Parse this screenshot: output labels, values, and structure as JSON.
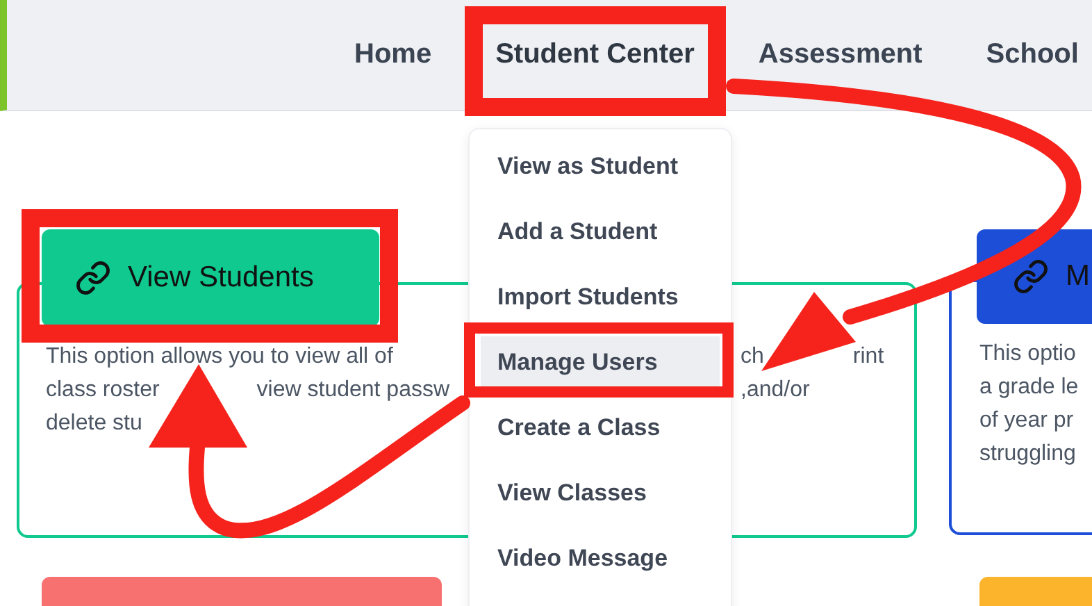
{
  "nav": {
    "items": [
      {
        "label": "Home",
        "selected": false
      },
      {
        "label": "Student Center",
        "selected": true
      },
      {
        "label": "Assessment",
        "selected": false
      },
      {
        "label": "School",
        "selected": false
      }
    ]
  },
  "menu": {
    "items": [
      {
        "label": "View as Student",
        "selected": false
      },
      {
        "label": "Add a Student",
        "selected": false
      },
      {
        "label": "Import Students",
        "selected": false
      },
      {
        "label": "Manage Users",
        "selected": true
      },
      {
        "label": "Create a Class",
        "selected": false
      },
      {
        "label": "View Classes",
        "selected": false
      },
      {
        "label": "Video Message",
        "selected": false
      }
    ]
  },
  "cards": [
    {
      "title": "View Students",
      "color": "#10c98f",
      "lines": [
        {
          "left": [
            "This option allows you to view all of"
          ],
          "right": [
            "ch",
            "rint"
          ]
        },
        {
          "left": [
            "class roster",
            "view student passw"
          ],
          "right": [
            ",and/or"
          ]
        },
        {
          "left": [
            "delete stu"
          ]
        }
      ]
    },
    {
      "title": "M",
      "color": "#1d4ed8",
      "lines": [
        {
          "left": [
            "This optio"
          ]
        },
        {
          "left": [
            "a grade le"
          ]
        },
        {
          "left": [
            "of year pr"
          ]
        },
        {
          "left": [
            "struggling"
          ]
        }
      ]
    }
  ],
  "next_cards": [
    {
      "color": "#f87171"
    },
    {
      "color": "#fbb42c"
    }
  ]
}
